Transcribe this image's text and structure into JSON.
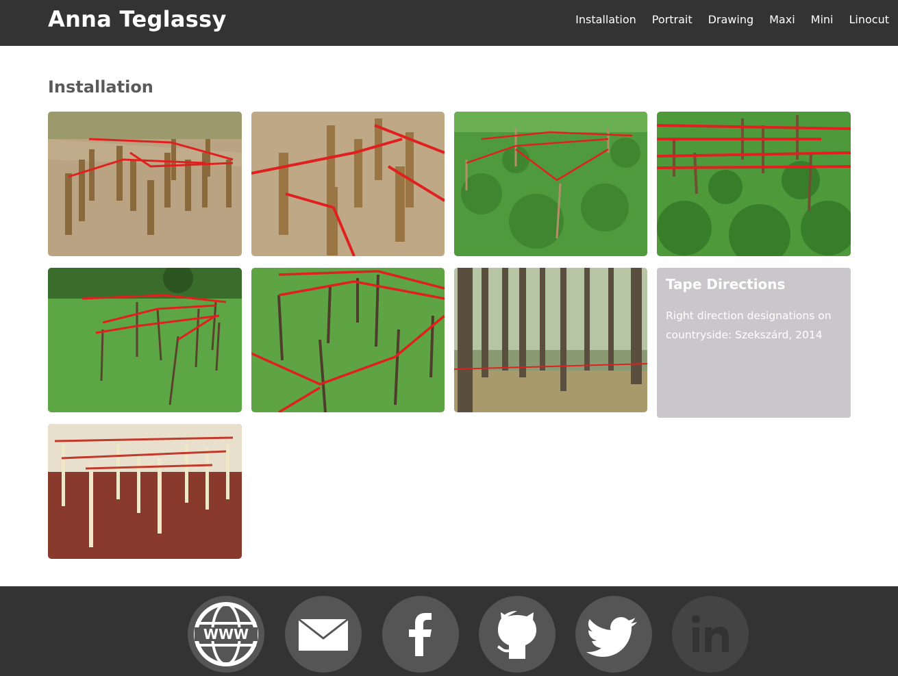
{
  "header": {
    "brand": "Anna Teglassy",
    "nav": [
      "Installation",
      "Portrait",
      "Drawing",
      "Maxi",
      "Mini",
      "Linocut"
    ]
  },
  "main": {
    "section_title": "Installation",
    "card": {
      "title": "Tape Directions",
      "text": "Right direction designations on countryside: Szekszárd, 2014"
    }
  },
  "footer": {
    "social": [
      "www-icon",
      "mail-icon",
      "facebook-icon",
      "github-icon",
      "twitter-icon",
      "linkedin-icon"
    ]
  },
  "colors": {
    "bar": "#333333",
    "tape": "#e0201e",
    "card": "#c9c7cc",
    "social_bg": "#555555"
  }
}
